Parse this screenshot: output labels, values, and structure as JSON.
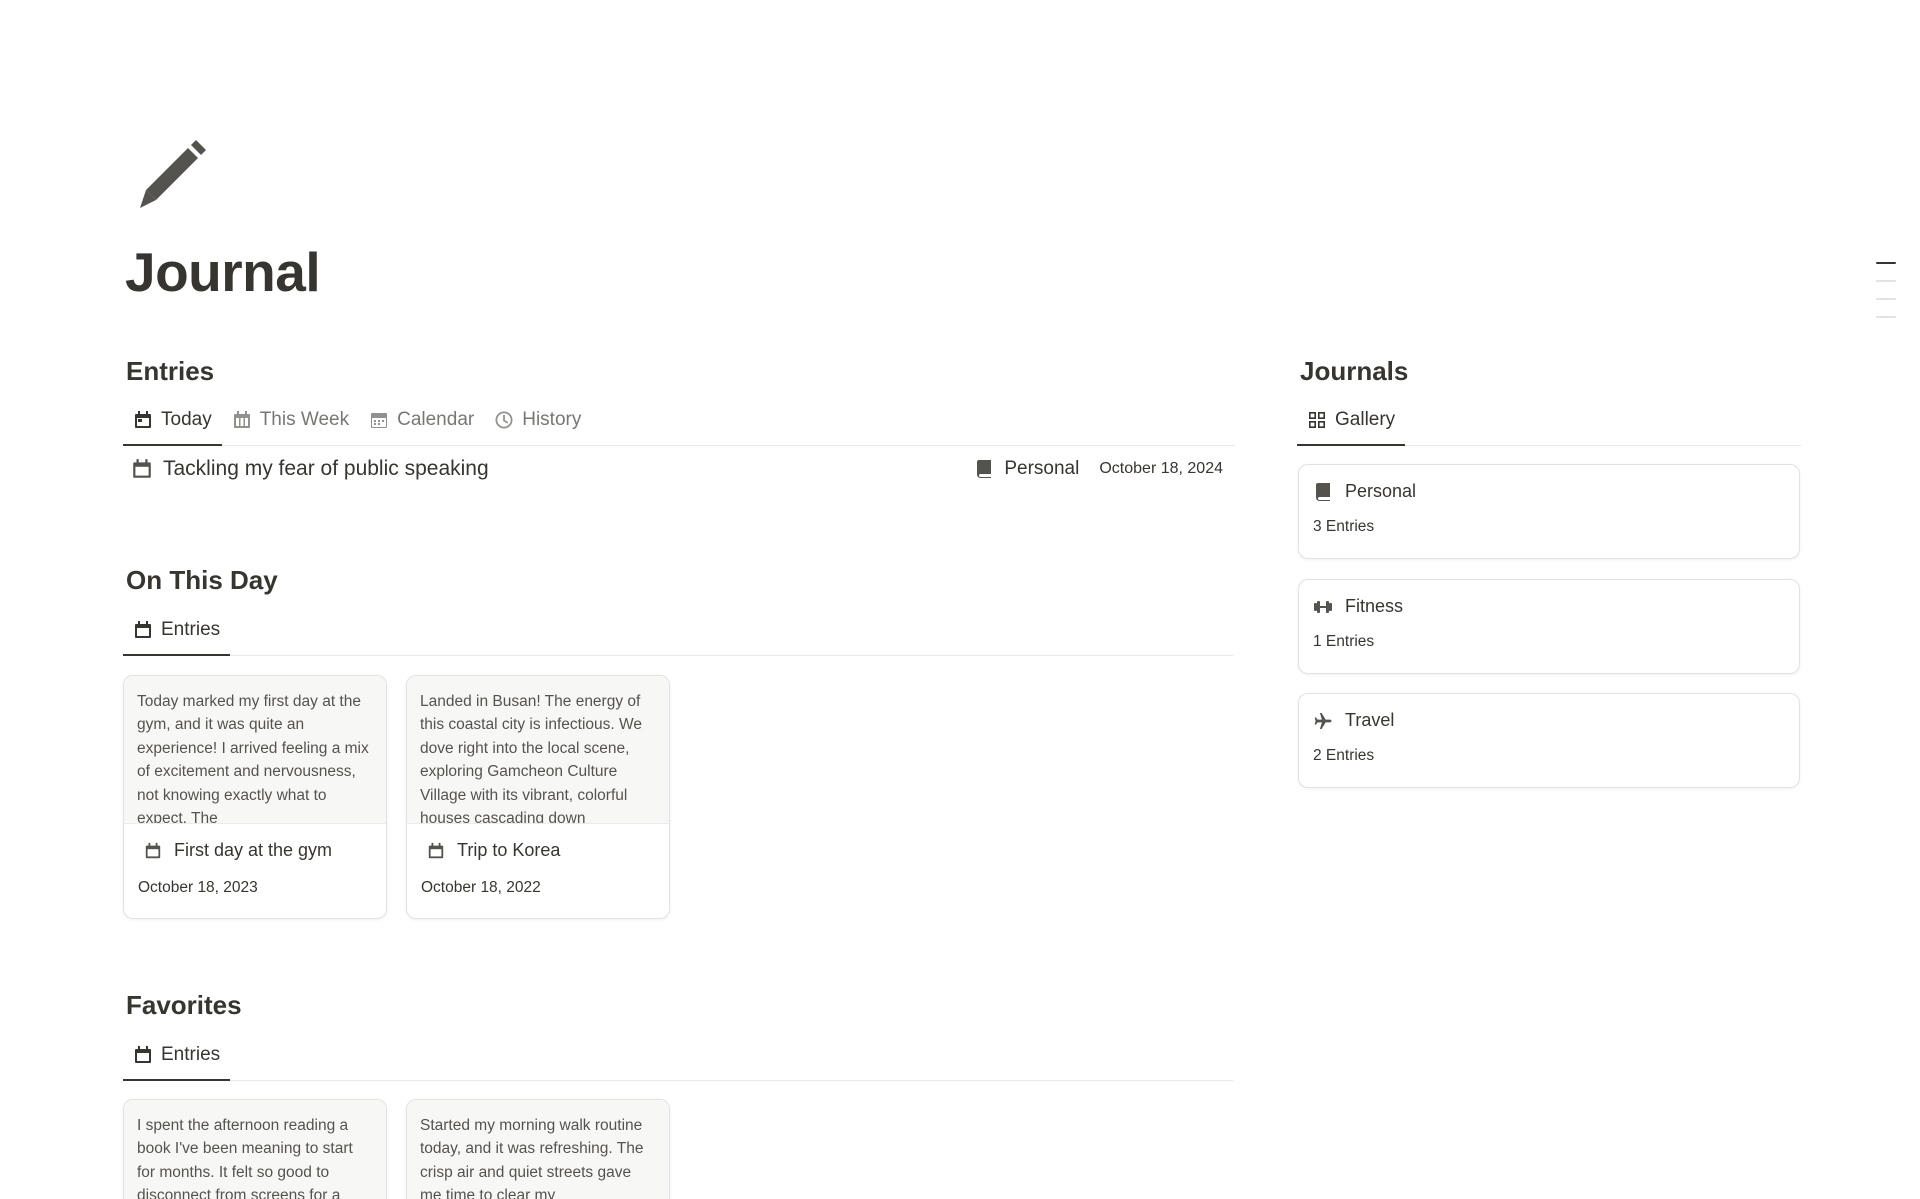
{
  "page": {
    "title": "Journal",
    "icon": "pencil-icon"
  },
  "entries_section": {
    "title": "Entries",
    "tabs": [
      {
        "label": "Today",
        "icon": "calendar-icon",
        "active": true
      },
      {
        "label": "This Week",
        "icon": "week-calendar-icon",
        "active": false
      },
      {
        "label": "Calendar",
        "icon": "calendar-outline-icon",
        "active": false
      },
      {
        "label": "History",
        "icon": "clock-icon",
        "active": false
      }
    ],
    "rows": [
      {
        "title": "Tackling my fear of public speaking",
        "journal": "Personal",
        "date": "October 18, 2024"
      }
    ]
  },
  "on_this_day": {
    "title": "On This Day",
    "view_label": "Entries",
    "cards": [
      {
        "preview": "Today marked my first day at the gym, and it was quite an experience! I arrived feeling a mix of excitement and nervousness, not knowing exactly what to expect. The",
        "title": "First day at the gym",
        "date": "October 18, 2023"
      },
      {
        "preview": "Landed in Busan! The energy of this coastal city is infectious. We dove right into the local scene, exploring Gamcheon Culture Village with its vibrant, colorful houses cascading down",
        "title": "Trip to Korea",
        "date": "October 18, 2022"
      }
    ]
  },
  "favorites": {
    "title": "Favorites",
    "view_label": "Entries",
    "cards": [
      {
        "preview": "I spent the afternoon reading a book I've been meaning to start for months. It felt so good to disconnect from screens for a"
      },
      {
        "preview": "Started my morning walk routine today, and it was refreshing. The crisp air and quiet streets gave me time to clear my"
      }
    ]
  },
  "journals": {
    "title": "Journals",
    "view_label": "Gallery",
    "items": [
      {
        "name": "Personal",
        "count": "3 Entries",
        "icon": "book-icon"
      },
      {
        "name": "Fitness",
        "count": "1 Entries",
        "icon": "dumbbell-icon"
      },
      {
        "name": "Travel",
        "count": "2 Entries",
        "icon": "airplane-icon"
      }
    ]
  }
}
